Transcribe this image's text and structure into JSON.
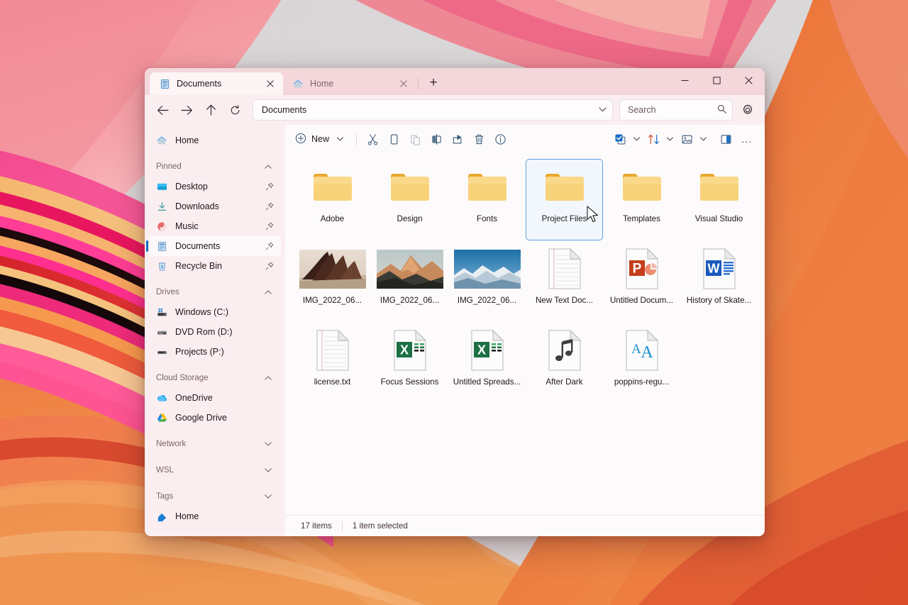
{
  "window": {
    "title": "Documents",
    "controls": {
      "minimize": "minimize-button",
      "maximize": "maximize-button",
      "close": "close-button"
    }
  },
  "tabs": [
    {
      "label": "Documents",
      "icon": "documents-folder-icon",
      "active": true
    },
    {
      "label": "Home",
      "icon": "home-icon",
      "active": false
    }
  ],
  "newtab_label": "+",
  "address": {
    "path": "Documents",
    "back": "Back",
    "forward": "Forward",
    "up": "Up",
    "refresh": "Refresh"
  },
  "search": {
    "placeholder": "Search",
    "value": ""
  },
  "settings_label": "See more",
  "toolbar": {
    "new_label": "New",
    "items": [
      {
        "name": "cut",
        "icon": "scissors-icon",
        "disabled": false
      },
      {
        "name": "copy",
        "icon": "copy-icon",
        "disabled": false
      },
      {
        "name": "paste",
        "icon": "paste-icon",
        "disabled": true
      },
      {
        "name": "rename",
        "icon": "rename-icon",
        "disabled": false
      },
      {
        "name": "share",
        "icon": "share-icon",
        "disabled": false
      },
      {
        "name": "delete",
        "icon": "trash-icon",
        "disabled": false
      },
      {
        "name": "properties",
        "icon": "info-icon",
        "disabled": false
      }
    ],
    "right_items": [
      {
        "name": "select",
        "icon": "select-all-icon"
      },
      {
        "name": "sort",
        "icon": "sort-icon"
      },
      {
        "name": "view",
        "icon": "view-icon"
      },
      {
        "name": "details-pane",
        "icon": "details-pane-icon"
      }
    ],
    "more_label": "..."
  },
  "sidebar": {
    "home": {
      "label": "Home",
      "icon": "home-icon"
    },
    "groups": [
      {
        "label": "Pinned",
        "expanded": true,
        "items": [
          {
            "label": "Desktop",
            "icon": "desktop-icon",
            "pinned": true
          },
          {
            "label": "Downloads",
            "icon": "downloads-icon",
            "pinned": true
          },
          {
            "label": "Music",
            "icon": "music-icon",
            "pinned": true
          },
          {
            "label": "Documents",
            "icon": "documents-icon",
            "pinned": true,
            "selected": true
          },
          {
            "label": "Recycle Bin",
            "icon": "recycle-bin-icon",
            "pinned": true
          }
        ]
      },
      {
        "label": "Drives",
        "expanded": true,
        "items": [
          {
            "label": "Windows (C:)",
            "icon": "windows-drive-icon",
            "pinned": false
          },
          {
            "label": "DVD Rom (D:)",
            "icon": "dvd-drive-icon",
            "pinned": false
          },
          {
            "label": "Projects (P:)",
            "icon": "drive-icon",
            "pinned": false
          }
        ]
      },
      {
        "label": "Cloud Storage",
        "expanded": true,
        "items": [
          {
            "label": "OneDrive",
            "icon": "onedrive-icon",
            "pinned": false
          },
          {
            "label": "Google Drive",
            "icon": "google-drive-icon",
            "pinned": false
          }
        ]
      },
      {
        "label": "Network",
        "expanded": false,
        "items": []
      },
      {
        "label": "WSL",
        "expanded": false,
        "items": []
      },
      {
        "label": "Tags",
        "expanded": false,
        "items": [
          {
            "label": "Home",
            "icon": "tag-icon",
            "pinned": false
          }
        ]
      }
    ]
  },
  "files": [
    {
      "label": "Adobe",
      "type": "folder",
      "selected": false
    },
    {
      "label": "Design",
      "type": "folder",
      "selected": false
    },
    {
      "label": "Fonts",
      "type": "folder",
      "selected": false
    },
    {
      "label": "Project Files",
      "type": "folder",
      "selected": true
    },
    {
      "label": "Templates",
      "type": "folder",
      "selected": false
    },
    {
      "label": "Visual Studio",
      "type": "folder",
      "selected": false
    },
    {
      "label": "IMG_2022_06...",
      "type": "photo-desert",
      "selected": false
    },
    {
      "label": "IMG_2022_06...",
      "type": "photo-peak",
      "selected": false
    },
    {
      "label": "IMG_2022_06...",
      "type": "photo-snow",
      "selected": false
    },
    {
      "label": "New Text Doc...",
      "type": "text",
      "selected": false
    },
    {
      "label": "Untitled Docum...",
      "type": "powerpoint",
      "selected": false
    },
    {
      "label": "History of Skate...",
      "type": "word",
      "selected": false
    },
    {
      "label": "license.txt",
      "type": "text",
      "selected": false
    },
    {
      "label": "Focus Sessions",
      "type": "excel",
      "selected": false
    },
    {
      "label": "Untitled Spreads...",
      "type": "excel",
      "selected": false
    },
    {
      "label": "After Dark",
      "type": "audio",
      "selected": false
    },
    {
      "label": "poppins-regu...",
      "type": "font",
      "selected": false
    }
  ],
  "status": {
    "item_count": "17 items",
    "selection": "1 item selected"
  },
  "colors": {
    "accent": "#0f6cbd",
    "selection_border": "#5e9fe0",
    "titlebar": "#f3d7db",
    "sidebar": "#fbeef0",
    "content": "#fdfafb",
    "folder": "#f5c14b",
    "excel": "#1d7044",
    "powerpoint": "#c43e1c",
    "word": "#185abd"
  }
}
